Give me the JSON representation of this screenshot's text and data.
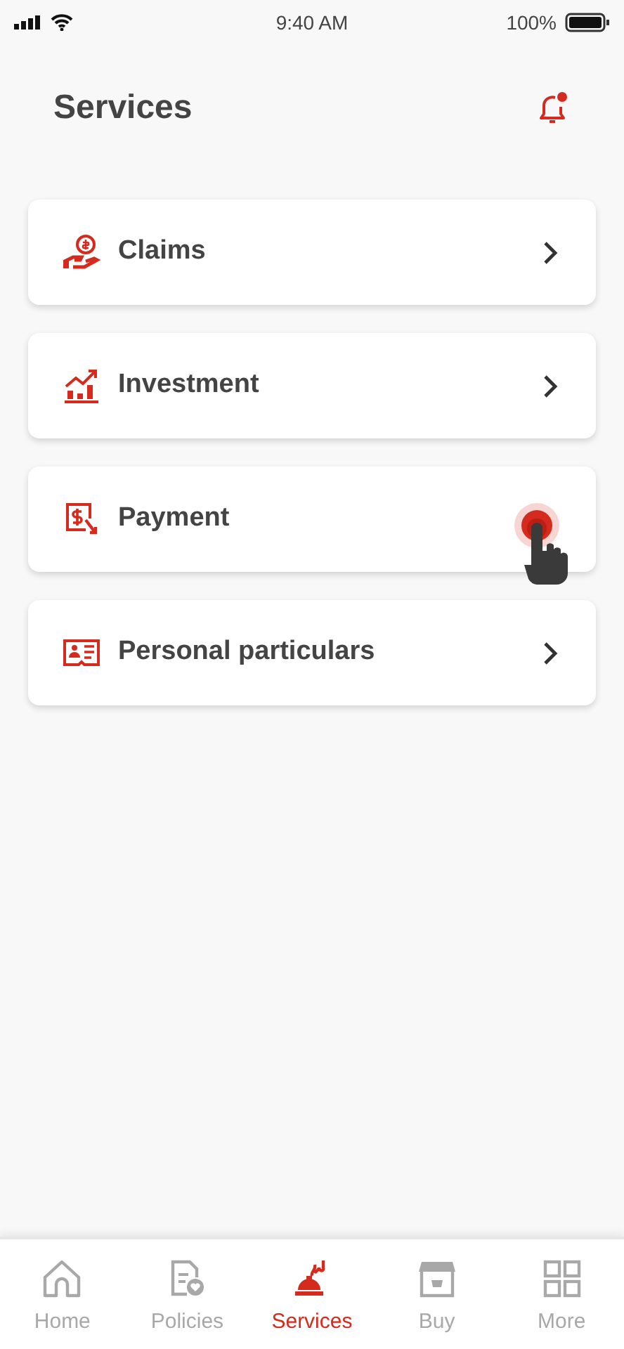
{
  "status_bar": {
    "time": "9:40 AM",
    "battery": "100%"
  },
  "header": {
    "title": "Services",
    "has_unread_notifications": true
  },
  "services": [
    {
      "label": "Claims",
      "tapped": false
    },
    {
      "label": "Investment",
      "tapped": false
    },
    {
      "label": "Payment",
      "tapped": true
    },
    {
      "label": "Personal particulars",
      "tapped": false
    }
  ],
  "tab_bar": [
    {
      "label": "Home",
      "selected": false
    },
    {
      "label": "Policies",
      "selected": false
    },
    {
      "label": "Services",
      "selected": true
    },
    {
      "label": "Buy",
      "selected": false
    },
    {
      "label": "More",
      "selected": false
    }
  ]
}
